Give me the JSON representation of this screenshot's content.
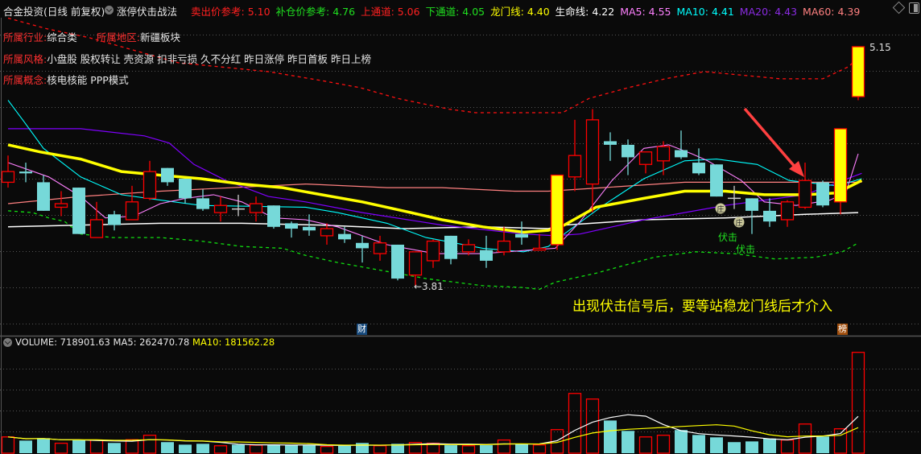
{
  "header": {
    "stock_title": "合金投资(日线 前复权)",
    "strategy": "涨停伏击战法",
    "indicators": [
      {
        "label": "卖出价参考:",
        "value": "5.10",
        "color": "#ff2020"
      },
      {
        "label": "补仓价参考:",
        "value": "4.76",
        "color": "#20e020"
      },
      {
        "label": "上通道:",
        "value": "5.06",
        "color": "#ff2020"
      },
      {
        "label": "下通道:",
        "value": "4.05",
        "color": "#20e020"
      },
      {
        "label": "龙门线:",
        "value": "4.40",
        "color": "#ffff00"
      },
      {
        "label": "生命线:",
        "value": "4.22",
        "color": "#ffffff"
      },
      {
        "label": "MA5:",
        "value": "4.55",
        "color": "#ff80ff"
      },
      {
        "label": "MA10:",
        "value": "4.41",
        "color": "#00ffff"
      },
      {
        "label": "MA20:",
        "value": "4.43",
        "color": "#8a2be2"
      },
      {
        "label": "MA60:",
        "value": "4.39",
        "color": "#ff8080"
      }
    ]
  },
  "info": {
    "industry_label": "所属行业:",
    "industry": "综合类",
    "region_label": "所属地区:",
    "region": "新疆板块",
    "style_label": "所属风格:",
    "style": "小盘股 股权转让 壳资源 扣非亏损 久不分红 昨日涨停 昨日首板 昨日上榜",
    "concept_label": "所属概念:",
    "concept": "核电核能 PPP模式"
  },
  "annotations": {
    "low_label": "←3.81",
    "high_label": "5.15",
    "signal_1": "伏击",
    "signal_2": "伏击",
    "note": "出现伏击信号后，要等站稳龙门线后才介入",
    "marker_finance": "财",
    "marker_list": "榜"
  },
  "volume_header": {
    "volume": "VOLUME: 718901.63",
    "ma5": "MA5: 262470.78",
    "ma10": "MA10: 181562.28"
  },
  "colors": {
    "up": "#ff0000",
    "down": "#76d9d9",
    "limit_up_fill": "#ffff00",
    "ma5": "#ff80ff",
    "ma10": "#00ffff",
    "ma20": "#8000ff",
    "ma60": "#ff8080",
    "dragon_gate": "#ffff00",
    "life_line": "#ffffff",
    "upper_channel": "#ff1010",
    "lower_channel": "#10e010",
    "vol_ma5": "#ffffff",
    "vol_ma10": "#ffff00"
  },
  "chart_data": {
    "type": "candlestick",
    "price_range": [
      3.81,
      5.15
    ],
    "ohlc": [
      [
        4.39,
        4.54,
        4.36,
        4.45
      ],
      [
        4.45,
        4.5,
        4.39,
        4.44
      ],
      [
        4.39,
        4.43,
        4.23,
        4.23
      ],
      [
        4.25,
        4.34,
        4.2,
        4.27
      ],
      [
        4.36,
        4.36,
        4.1,
        4.1
      ],
      [
        4.08,
        4.28,
        4.08,
        4.18
      ],
      [
        4.21,
        4.23,
        4.12,
        4.15
      ],
      [
        4.18,
        4.37,
        4.18,
        4.28
      ],
      [
        4.3,
        4.51,
        4.29,
        4.45
      ],
      [
        4.47,
        4.47,
        4.37,
        4.39
      ],
      [
        4.41,
        4.41,
        4.27,
        4.3
      ],
      [
        4.3,
        4.35,
        4.23,
        4.24
      ],
      [
        4.22,
        4.31,
        4.17,
        4.26
      ],
      [
        4.24,
        4.32,
        4.2,
        4.24
      ],
      [
        4.22,
        4.31,
        4.17,
        4.27
      ],
      [
        4.26,
        4.26,
        4.13,
        4.14
      ],
      [
        4.16,
        4.17,
        4.08,
        4.13
      ],
      [
        4.14,
        4.21,
        4.09,
        4.12
      ],
      [
        4.09,
        4.16,
        4.04,
        4.13
      ],
      [
        4.1,
        4.14,
        4.05,
        4.07
      ],
      [
        4.05,
        4.09,
        3.94,
        4.02
      ],
      [
        3.99,
        4.09,
        3.95,
        4.05
      ],
      [
        4.04,
        4.04,
        3.84,
        3.85
      ],
      [
        3.87,
        4.0,
        3.81,
        4.0
      ],
      [
        3.95,
        4.07,
        3.91,
        4.06
      ],
      [
        4.09,
        4.09,
        3.93,
        3.96
      ],
      [
        4.0,
        4.07,
        3.98,
        4.04
      ],
      [
        4.01,
        4.09,
        3.91,
        3.95
      ],
      [
        4.0,
        4.14,
        3.98,
        4.06
      ],
      [
        4.1,
        4.17,
        4.04,
        4.08
      ],
      [
        4.01,
        4.1,
        4.01,
        4.02
      ],
      [
        4.04,
        4.43,
        4.01,
        4.43
      ],
      [
        4.42,
        4.74,
        4.34,
        4.54
      ],
      [
        4.38,
        4.8,
        4.22,
        4.74
      ],
      [
        4.62,
        4.67,
        4.51,
        4.6
      ],
      [
        4.6,
        4.63,
        4.43,
        4.53
      ],
      [
        4.49,
        4.56,
        4.44,
        4.56
      ],
      [
        4.51,
        4.62,
        4.43,
        4.59
      ],
      [
        4.57,
        4.68,
        4.52,
        4.53
      ],
      [
        4.5,
        4.58,
        4.43,
        4.44
      ],
      [
        4.49,
        4.49,
        4.31,
        4.31
      ],
      [
        4.3,
        4.37,
        4.24,
        4.3
      ],
      [
        4.3,
        4.3,
        4.1,
        4.23
      ],
      [
        4.23,
        4.3,
        4.14,
        4.17
      ],
      [
        4.18,
        4.29,
        4.14,
        4.28
      ],
      [
        4.25,
        4.5,
        4.24,
        4.4
      ],
      [
        4.39,
        4.4,
        4.25,
        4.26
      ],
      [
        4.28,
        4.69,
        4.21,
        4.69
      ],
      [
        4.87,
        5.15,
        4.85,
        5.15
      ]
    ],
    "limit_up_indices": [
      31,
      47,
      48
    ],
    "volume": [
      116000,
      90000,
      107000,
      71000,
      92000,
      94000,
      73000,
      96000,
      128000,
      79000,
      61000,
      67000,
      53000,
      61000,
      57000,
      61000,
      57000,
      57000,
      48000,
      53000,
      73000,
      53000,
      67000,
      76000,
      71000,
      57000,
      53000,
      57000,
      94000,
      67000,
      59000,
      168000,
      426000,
      386000,
      233000,
      159000,
      116000,
      128000,
      165000,
      130000,
      113000,
      79000,
      84000,
      105000,
      94000,
      208000,
      119000,
      174000,
      718901.63
    ],
    "volume_max": 718901.63,
    "lines": {
      "ma5": [
        [
          0,
          4.5
        ],
        [
          2.3,
          4.42
        ],
        [
          4.1,
          4.31
        ],
        [
          5.5,
          4.19
        ],
        [
          7.1,
          4.2
        ],
        [
          8.6,
          4.27
        ],
        [
          10,
          4.3
        ],
        [
          11.6,
          4.32
        ],
        [
          13.2,
          4.28
        ],
        [
          15,
          4.19
        ],
        [
          16.8,
          4.18
        ],
        [
          18.6,
          4.14
        ],
        [
          21.4,
          4.04
        ],
        [
          24.1,
          3.99
        ],
        [
          26.8,
          3.99
        ],
        [
          29.5,
          4.01
        ],
        [
          30.9,
          4.02
        ],
        [
          32.3,
          4.17
        ],
        [
          34.1,
          4.4
        ],
        [
          35.9,
          4.58
        ],
        [
          37.3,
          4.6
        ],
        [
          38.6,
          4.55
        ],
        [
          39.5,
          4.51
        ],
        [
          41.4,
          4.4
        ],
        [
          42.7,
          4.28
        ],
        [
          44.5,
          4.26
        ],
        [
          46.4,
          4.29
        ],
        [
          47.3,
          4.33
        ],
        [
          48,
          4.55
        ]
      ],
      "ma10": [
        [
          0,
          4.85
        ],
        [
          0.9,
          4.73
        ],
        [
          2,
          4.58
        ],
        [
          4.1,
          4.42
        ],
        [
          6.4,
          4.32
        ],
        [
          8.6,
          4.29
        ],
        [
          10.9,
          4.26
        ],
        [
          16.8,
          4.25
        ],
        [
          18.6,
          4.22
        ],
        [
          21.4,
          4.16
        ],
        [
          23.6,
          4.08
        ],
        [
          26.8,
          4.02
        ],
        [
          29.1,
          4.0
        ],
        [
          30.5,
          4.03
        ],
        [
          31.4,
          4.1
        ],
        [
          33.6,
          4.26
        ],
        [
          35.9,
          4.41
        ],
        [
          38.2,
          4.51
        ],
        [
          40,
          4.52
        ],
        [
          42.3,
          4.49
        ],
        [
          44.1,
          4.4
        ],
        [
          46.8,
          4.37
        ],
        [
          48.2,
          4.41
        ]
      ],
      "ma20": [
        [
          0,
          4.69
        ],
        [
          4.1,
          4.69
        ],
        [
          7.7,
          4.65
        ],
        [
          9.1,
          4.61
        ],
        [
          10.5,
          4.49
        ],
        [
          12.3,
          4.4
        ],
        [
          14.7,
          4.31
        ],
        [
          16.8,
          4.28
        ],
        [
          20,
          4.22
        ],
        [
          24.5,
          4.15
        ],
        [
          29.1,
          4.1
        ],
        [
          30.9,
          4.09
        ],
        [
          32.3,
          4.1
        ],
        [
          35.9,
          4.18
        ],
        [
          40.5,
          4.26
        ],
        [
          45,
          4.32
        ],
        [
          48.2,
          4.44
        ]
      ],
      "ma60": [
        [
          0,
          4.27
        ],
        [
          4.1,
          4.31
        ],
        [
          8.6,
          4.34
        ],
        [
          16.8,
          4.38
        ],
        [
          21.4,
          4.36
        ],
        [
          24.5,
          4.36
        ],
        [
          28.6,
          4.34
        ],
        [
          30.5,
          4.34
        ],
        [
          33.6,
          4.36
        ],
        [
          38.2,
          4.39
        ],
        [
          48.2,
          4.39
        ]
      ],
      "dragon_gate": [
        [
          0,
          4.6
        ],
        [
          1.8,
          4.56
        ],
        [
          4.1,
          4.52
        ],
        [
          6.4,
          4.45
        ],
        [
          8.6,
          4.43
        ],
        [
          10.9,
          4.41
        ],
        [
          13.2,
          4.38
        ],
        [
          15.5,
          4.36
        ],
        [
          17.7,
          4.32
        ],
        [
          20,
          4.28
        ],
        [
          22.3,
          4.23
        ],
        [
          24.5,
          4.18
        ],
        [
          26.8,
          4.14
        ],
        [
          29.1,
          4.11
        ],
        [
          30.5,
          4.12
        ],
        [
          31.4,
          4.15
        ],
        [
          33.2,
          4.25
        ],
        [
          35.9,
          4.3
        ],
        [
          38.2,
          4.34
        ],
        [
          40.5,
          4.34
        ],
        [
          42.7,
          4.32
        ],
        [
          45,
          4.32
        ],
        [
          46.8,
          4.33
        ],
        [
          48.2,
          4.4
        ]
      ],
      "life_line": [
        [
          0,
          4.14
        ],
        [
          4.1,
          4.15
        ],
        [
          8.6,
          4.16
        ],
        [
          13.2,
          4.16
        ],
        [
          17.7,
          4.15
        ],
        [
          22.3,
          4.13
        ],
        [
          26.8,
          4.14
        ],
        [
          30.5,
          4.13
        ],
        [
          31.4,
          4.15
        ],
        [
          35.9,
          4.18
        ],
        [
          40.5,
          4.19
        ],
        [
          45,
          4.21
        ],
        [
          48,
          4.22
        ]
      ],
      "upper_channel": [
        [
          0,
          5.31
        ],
        [
          2.2,
          5.25
        ],
        [
          4.6,
          5.2
        ],
        [
          9.6,
          5.06
        ],
        [
          14.7,
          5.01
        ],
        [
          17.7,
          4.96
        ],
        [
          19.9,
          4.92
        ],
        [
          22,
          4.86
        ],
        [
          24.9,
          4.8
        ],
        [
          26.4,
          4.78
        ],
        [
          31.3,
          4.78
        ],
        [
          32.8,
          4.86
        ],
        [
          35,
          4.92
        ],
        [
          37.1,
          4.97
        ],
        [
          39.3,
          5.01
        ],
        [
          41.5,
          4.99
        ],
        [
          43.6,
          4.97
        ],
        [
          46,
          4.97
        ],
        [
          47.5,
          5.04
        ],
        [
          48.2,
          5.12
        ]
      ],
      "lower_channel": [
        [
          0,
          4.23
        ],
        [
          1.4,
          4.22
        ],
        [
          2.3,
          4.19
        ],
        [
          3.2,
          4.17
        ],
        [
          4.1,
          4.1
        ],
        [
          5.9,
          4.08
        ],
        [
          6.8,
          4.08
        ],
        [
          8.6,
          4.08
        ],
        [
          10.9,
          4.06
        ],
        [
          13.2,
          4.03
        ],
        [
          15.5,
          4.02
        ],
        [
          16.8,
          3.98
        ],
        [
          18.6,
          3.94
        ],
        [
          21.4,
          3.89
        ],
        [
          23.6,
          3.85
        ],
        [
          26.8,
          3.81
        ],
        [
          29.1,
          3.8
        ],
        [
          30,
          3.79
        ],
        [
          30.9,
          3.83
        ],
        [
          33.2,
          3.88
        ],
        [
          35,
          3.93
        ],
        [
          36.5,
          3.97
        ],
        [
          38.8,
          4.0
        ],
        [
          41,
          3.99
        ],
        [
          43.3,
          3.96
        ],
        [
          45.6,
          3.97
        ],
        [
          47.1,
          4.0
        ],
        [
          48,
          4.05
        ]
      ]
    }
  }
}
